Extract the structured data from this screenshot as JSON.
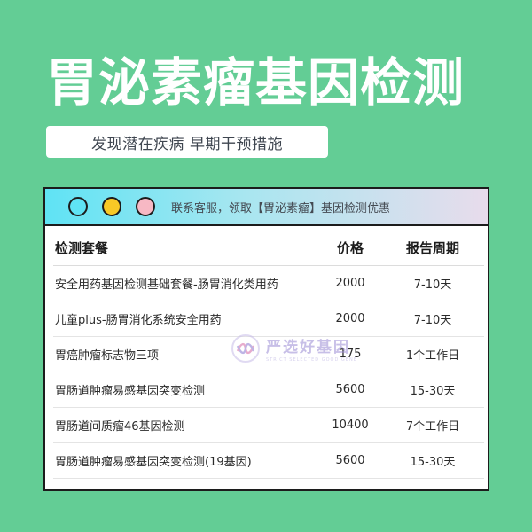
{
  "title": "胃泌素瘤基因检测",
  "subtitle": "发现潜在疾病 早期干预措施",
  "window": {
    "dots": [
      {
        "color": "#5fe3f4"
      },
      {
        "color": "#f8c926"
      },
      {
        "color": "#f7b8c4"
      }
    ],
    "bar_text": "联系客服，领取【胃泌素瘤】基因检测优惠"
  },
  "table": {
    "headers": [
      "检测套餐",
      "价格",
      "报告周期"
    ],
    "rows": [
      [
        "安全用药基因检测基础套餐-肠胃消化类用药",
        "2000",
        "7-10天"
      ],
      [
        "儿童plus-肠胃消化系统安全用药",
        "2000",
        "7-10天"
      ],
      [
        "胃癌肿瘤标志物三项",
        "175",
        "1个工作日"
      ],
      [
        "胃肠道肿瘤易感基因突变检测",
        "5600",
        "15-30天"
      ],
      [
        "胃肠道间质瘤46基因检测",
        "10400",
        "7个工作日"
      ],
      [
        "胃肠道肿瘤易感基因突变检测(19基因)",
        "5600",
        "15-30天"
      ]
    ]
  },
  "watermark": {
    "name": "严选好基因",
    "tagline": "STRICT SELECTED GOOD GENE"
  },
  "colors": {
    "background": "#63cd95",
    "window_border": "#1c1c1c"
  }
}
